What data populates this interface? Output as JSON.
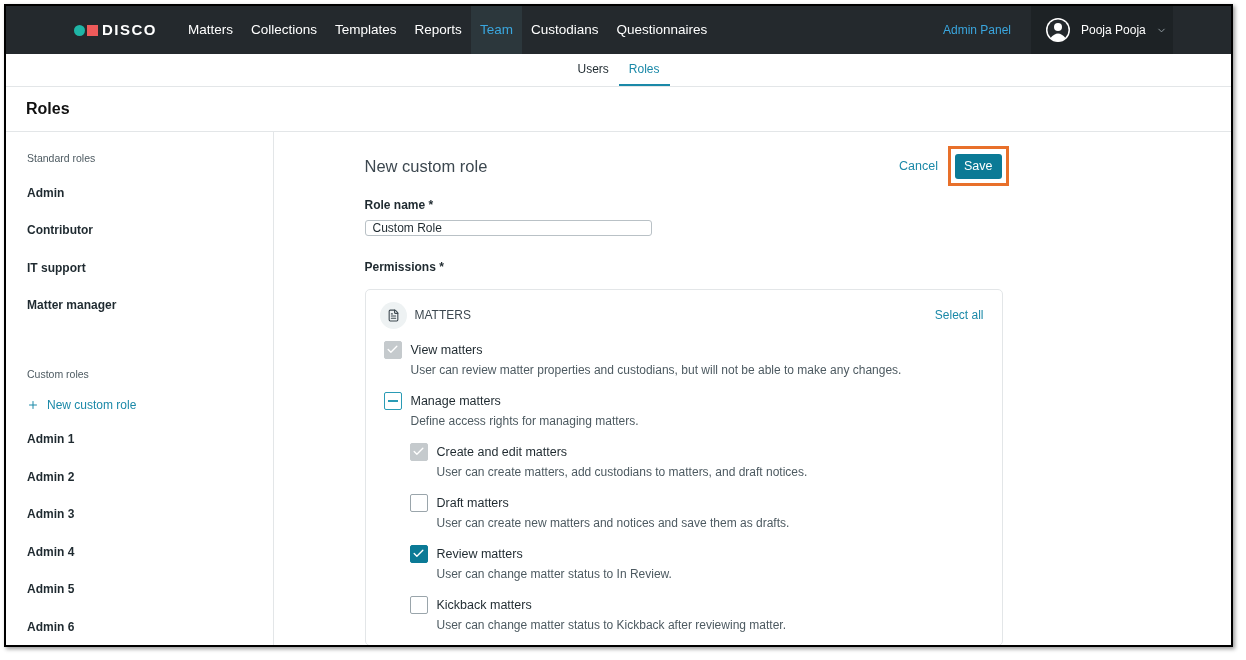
{
  "navbar": {
    "logo": "DISCO",
    "items": [
      {
        "label": "Matters",
        "selected": false
      },
      {
        "label": "Collections",
        "selected": false
      },
      {
        "label": "Templates",
        "selected": false
      },
      {
        "label": "Reports",
        "selected": false
      },
      {
        "label": "Team",
        "selected": true
      },
      {
        "label": "Custodians",
        "selected": false
      },
      {
        "label": "Questionnaires",
        "selected": false
      }
    ],
    "admin_link": "Admin Panel",
    "user_name": "Pooja Pooja"
  },
  "subtabs": [
    {
      "label": "Users",
      "selected": false
    },
    {
      "label": "Roles",
      "selected": true
    }
  ],
  "page_title": "Roles",
  "sidebar": {
    "sections": [
      {
        "heading": "Standard roles",
        "items": [
          "Admin",
          "Contributor",
          "IT support",
          "Matter manager"
        ]
      },
      {
        "heading": "Custom roles",
        "add_link": "New custom role",
        "items": [
          "Admin 1",
          "Admin 2",
          "Admin 3",
          "Admin 4",
          "Admin 5",
          "Admin 6"
        ]
      }
    ]
  },
  "form": {
    "title": "New custom role",
    "cancel": "Cancel",
    "save": {
      "label": "Save",
      "highlighted": true
    },
    "role_name_label": "Role name *",
    "role_name_value": "Custom Role",
    "permissions_label": "Permissions *",
    "group": {
      "title": "MATTERS",
      "select_all": "Select all",
      "permissions": [
        {
          "label": "View matters",
          "description": "User can review matter properties and custodians, but will not be able to make any changes.",
          "checked": true,
          "disabled": true
        },
        {
          "label": "Manage matters",
          "description": "Define access rights for managing matters.",
          "indeterminate": true,
          "disabled": false,
          "children": [
            {
              "label": "Create and edit matters",
              "description": "User can create matters, add custodians to matters, and draft notices.",
              "checked": true,
              "disabled": true
            },
            {
              "label": "Draft matters",
              "description": "User can create new matters and notices and save them as drafts.",
              "checked": false,
              "disabled": false
            },
            {
              "label": "Review matters",
              "description": "User can change matter status to In Review.",
              "checked": true,
              "disabled": false
            },
            {
              "label": "Kickback matters",
              "description": "User can change matter status to Kickback after reviewing matter.",
              "checked": false,
              "disabled": false
            }
          ]
        }
      ]
    }
  }
}
